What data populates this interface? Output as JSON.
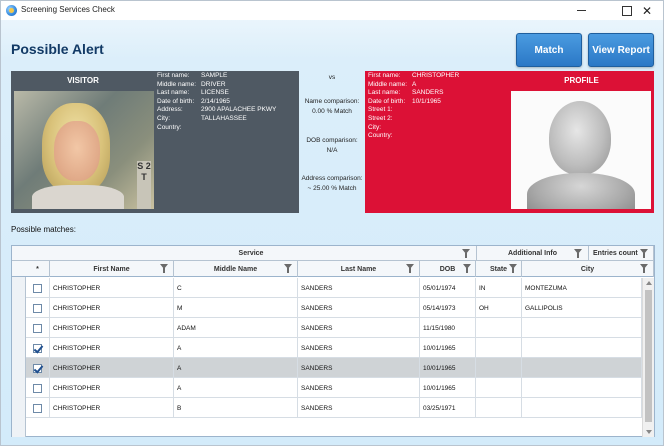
{
  "window": {
    "title": "Screening Services Check"
  },
  "header": {
    "title": "Possible Alert",
    "match_label": "Match",
    "view_report_label": "View Report"
  },
  "visitor": {
    "heading": "VISITOR",
    "labels": [
      "First name:",
      "Middle name:",
      "Last name:",
      "Date of birth:",
      "Address:",
      "City:",
      "Country:"
    ],
    "values": [
      "SAMPLE",
      "DRIVER",
      "LICENSE",
      "2/14/1965",
      "2900 APALACHEE PKWY",
      "TALLAHASSEE",
      ""
    ],
    "photo_side_text": "S 2 T"
  },
  "comparison": {
    "vs": "vs",
    "name_label": "Name comparison:",
    "name_value": "0.00 % Match",
    "dob_label": "DOB comparison:",
    "dob_value": "N/A",
    "address_label": "Address comparison:",
    "address_value": "~ 25.00 % Match"
  },
  "profile": {
    "heading": "PROFILE",
    "labels": [
      "First name:",
      "Middle name:",
      "Last name:",
      "Date of birth:",
      "Street 1:",
      "Street 2:",
      "City:",
      "Country:"
    ],
    "values": [
      "CHRISTOPHER",
      "A",
      "SANDERS",
      "10/1/1965",
      "",
      "",
      "",
      ""
    ]
  },
  "matches": {
    "label": "Possible matches:",
    "groups": [
      "Service",
      "Additional Info",
      "Entries count"
    ],
    "select_all": "*",
    "columns": [
      "First Name",
      "Middle Name",
      "Last Name",
      "DOB",
      "State",
      "City"
    ],
    "rows": [
      {
        "checked": false,
        "selected": false,
        "first": "CHRISTOPHER",
        "middle": "C",
        "last": "SANDERS",
        "dob": "05/01/1974",
        "state": "IN",
        "city": "MONTEZUMA"
      },
      {
        "checked": false,
        "selected": false,
        "first": "CHRISTOPHER",
        "middle": "M",
        "last": "SANDERS",
        "dob": "05/14/1973",
        "state": "OH",
        "city": "GALLIPOLIS"
      },
      {
        "checked": false,
        "selected": false,
        "first": "CHRISTOPHER",
        "middle": "ADAM",
        "last": "SANDERS",
        "dob": "11/15/1980",
        "state": "",
        "city": ""
      },
      {
        "checked": true,
        "selected": false,
        "first": "CHRISTOPHER",
        "middle": "A",
        "last": "SANDERS",
        "dob": "10/01/1965",
        "state": "",
        "city": ""
      },
      {
        "checked": true,
        "selected": true,
        "first": "CHRISTOPHER",
        "middle": "A",
        "last": "SANDERS",
        "dob": "10/01/1965",
        "state": "",
        "city": ""
      },
      {
        "checked": false,
        "selected": false,
        "first": "CHRISTOPHER",
        "middle": "A",
        "last": "SANDERS",
        "dob": "10/01/1965",
        "state": "",
        "city": ""
      },
      {
        "checked": false,
        "selected": false,
        "first": "CHRISTOPHER",
        "middle": "B",
        "last": "SANDERS",
        "dob": "03/25/1971",
        "state": "",
        "city": ""
      }
    ]
  }
}
